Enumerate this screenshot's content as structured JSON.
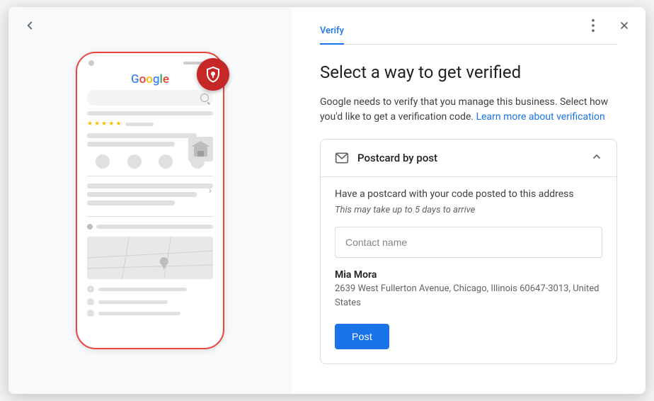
{
  "dialog": {
    "back_icon": "←",
    "more_icon": "⋮",
    "close_icon": "✕"
  },
  "tab": {
    "label": "Verify",
    "active": true
  },
  "header": {
    "title": "Select a way to get verified",
    "description": "Google needs to verify that you manage this business. Select how you'd like to get a verification code.",
    "learn_more_text": "Learn more about verification"
  },
  "postcard": {
    "section_title": "Postcard by post",
    "section_desc": "Have a postcard with your code posted to this address",
    "section_note": "This may take up to 5 days to arrive",
    "input_placeholder": "Contact name",
    "address_name": "Mia Mora",
    "address_line1": "2639 West Fullerton Avenue, Chicago, Illinois 60647-3013, United States",
    "post_button": "Post"
  },
  "phone": {
    "google_logo": "Google"
  }
}
